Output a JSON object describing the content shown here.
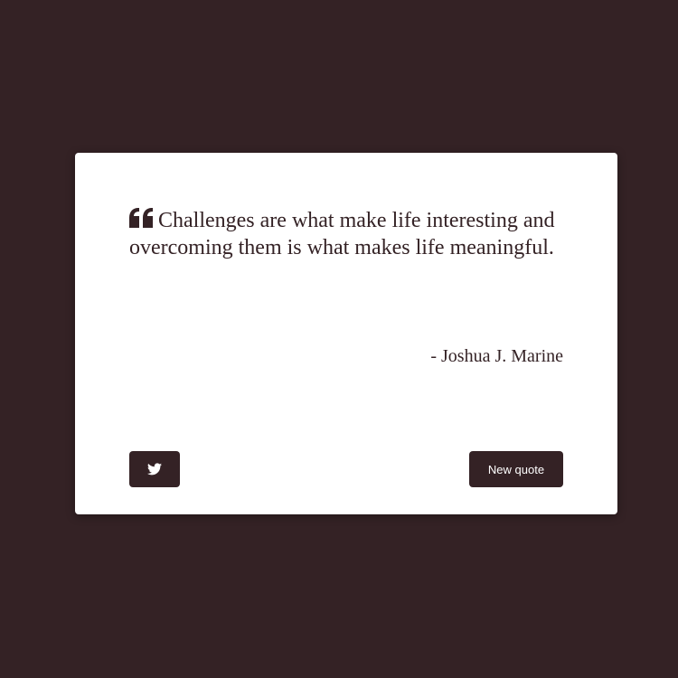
{
  "quote": {
    "text": "Challenges are what make life interesting and overcoming them is what makes life meaningful.",
    "author": "- Joshua J. Marine"
  },
  "buttons": {
    "new_quote_label": "New quote",
    "tweet_icon": "twitter-icon"
  },
  "colors": {
    "background": "#342225",
    "card": "#ffffff",
    "accent": "#342225"
  }
}
